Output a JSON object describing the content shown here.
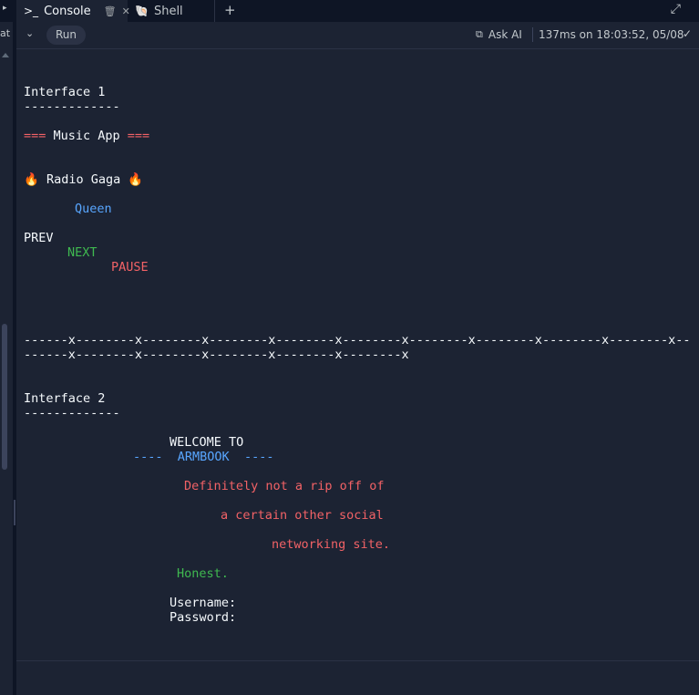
{
  "sidebar": {
    "label": "at"
  },
  "tabs": [
    {
      "label": "Console",
      "icon": "terminal-icon"
    },
    {
      "label": "Shell",
      "icon": "shell-icon"
    }
  ],
  "toolbar": {
    "run_label": "Run",
    "ask_ai_label": "Ask AI",
    "timing": "137ms on 18:03:52, 05/08"
  },
  "console": {
    "iface1_title": "Interface 1",
    "iface1_rule": "-------------",
    "music_marks_left": "===",
    "music_title": " Music App ",
    "music_marks_right": "===",
    "song_fire": "🔥",
    "song_title": " Radio Gaga ",
    "artist": "Queen",
    "prev": "PREV",
    "next": "NEXT",
    "pause": "PAUSE",
    "pattern_line1": "------x--------x--------x--------x--------x--------x--------x--------x--------x--------x--",
    "pattern_line2": "------x--------x--------x--------x--------x--------x",
    "iface2_title": "Interface 2",
    "iface2_rule": "-------------",
    "welcome": "WELCOME TO",
    "brand_left": "----",
    "brand": "ARMBOOK",
    "brand_right": "----",
    "tagline1": "Definitely not a rip off of",
    "tagline2": "a certain other social",
    "tagline3": "networking site.",
    "honest": "Honest.",
    "username_label": "Username:",
    "password_label": "Password:"
  },
  "colors": {
    "background": "#1c2333",
    "red": "#f26266",
    "blue": "#58a6ff",
    "green": "#3fb950"
  }
}
